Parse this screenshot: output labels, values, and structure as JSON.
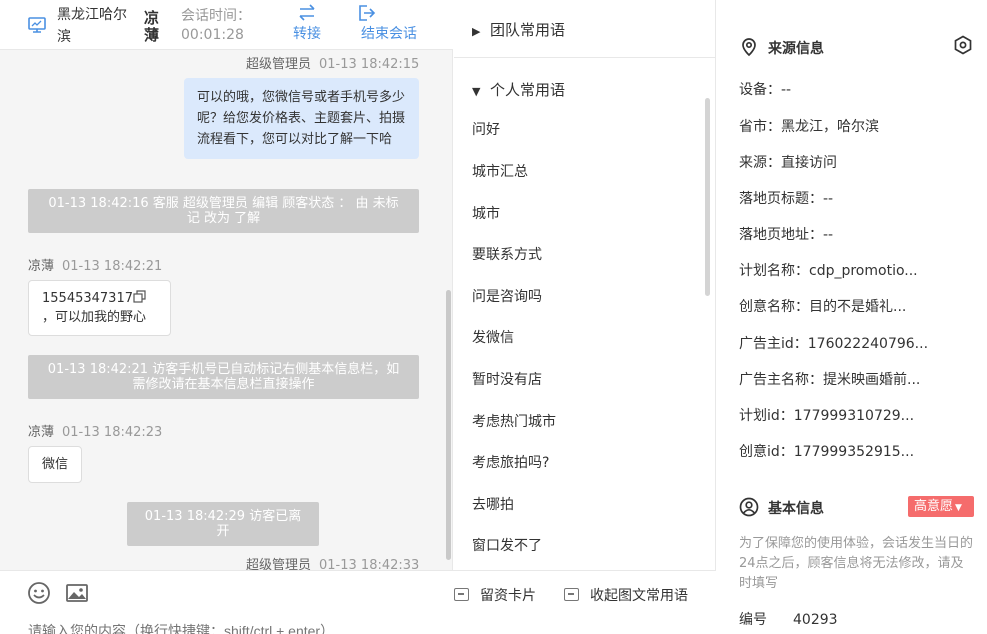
{
  "header": {
    "location": "黑龙江哈尔滨",
    "visitor_name": "凉薄",
    "session_time_label": "会话时间：",
    "session_time": "00:01:28",
    "transfer_label": "转接",
    "end_label": "结束会话"
  },
  "messages": {
    "m1_sender": "超级管理员",
    "m1_time": "01-13 18:42:15",
    "m1_text": "可以的哦，您微信号或者手机号多少呢？给您发价格表、主题套片、拍摄流程看下，您可以对比了解一下哈",
    "s1_text": "01-13 18:42:16 客服 超级管理员 编辑 顾客状态 ： 由 未标记 改为 了解",
    "m2_sender": "凉薄",
    "m2_time": "01-13 18:42:21",
    "m2_phone": "15545347317",
    "m2_text": "，可以加我的野心",
    "s2_text": "01-13 18:42:21 访客手机号已自动标记右侧基本信息栏，如需修改请在基本信息栏直接操作",
    "m3_sender": "凉薄",
    "m3_time": "01-13 18:42:23",
    "m3_text": "微信",
    "s3_text": "01-13 18:42:29 访客已离开",
    "m4_sender": "超级管理员",
    "m4_time": "01-13 18:42:33"
  },
  "composer": {
    "lead_card_label": "留资卡片",
    "collapse_label": "收起图文常用语",
    "input_placeholder": "请输入您的内容（换行快捷键：shift/ctrl + enter）"
  },
  "phrases": {
    "team_group": "团队常用语",
    "personal_group": "个人常用语",
    "items": [
      "问好",
      "城市汇总",
      "城市",
      "要联系方式",
      "问是咨询吗",
      "发微信",
      "暂时没有店",
      "考虑热门城市",
      "考虑旅拍吗?",
      "去哪拍",
      "窗口发不了"
    ]
  },
  "info": {
    "source_title": "来源信息",
    "device": "设备：--",
    "province": "省市：黑龙江，哈尔滨",
    "source": "来源：直接访问",
    "landing_title": "落地页标题：--",
    "landing_url": "落地页地址：--",
    "plan_name": "计划名称：cdp_promotio...",
    "creative_name": "创意名称：目的不是婚礼...",
    "advertiser_id": "广告主id：176022240796...",
    "advertiser_name": "广告主名称：提米映画婚前...",
    "plan_id": "计划id：177999310729...",
    "creative_id": "创意id：177999352915...",
    "basic_title": "基本信息",
    "intent_badge": "高意愿",
    "notice": "为了保障您的使用体验，会话发生当日的24点之后，顾客信息将无法修改，请及时填写",
    "id_label": "编号",
    "id_value": "40293"
  },
  "colors": {
    "accent": "#4a90e2",
    "agent_bubble": "#dbe9fc",
    "system_notice": "#cccccc",
    "badge": "#f56c6c"
  },
  "icons": {
    "header": "monitor-icon",
    "transfer": "transfer-arrows-icon",
    "end": "exit-icon",
    "emoji": "emoji-icon",
    "image": "image-icon",
    "location": "location-pin-icon",
    "settings": "hexagon-gear-icon",
    "user": "user-circle-icon",
    "copy": "copy-icon"
  }
}
